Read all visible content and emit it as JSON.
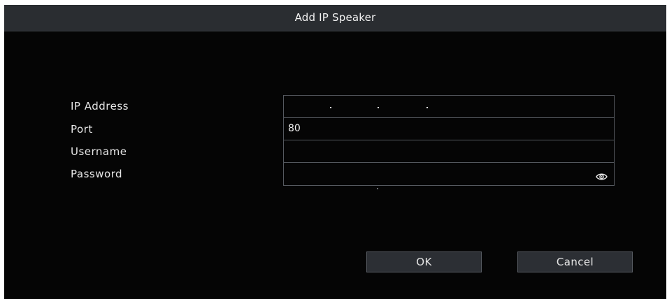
{
  "dialog": {
    "title": "Add IP Speaker"
  },
  "form": {
    "ip_address": {
      "label": "IP Address",
      "value": ". . ."
    },
    "port": {
      "label": "Port",
      "value": "80"
    },
    "username": {
      "label": "Username",
      "value": ""
    },
    "password": {
      "label": "Password",
      "value": "",
      "toggle_icon": "eye-icon"
    }
  },
  "buttons": {
    "ok_label": "OK",
    "cancel_label": "Cancel"
  },
  "colors": {
    "background": "#050505",
    "titlebar": "#2a2d31",
    "field_border": "#55595f",
    "button": "#2c2f34",
    "text": "#e6e6e6"
  }
}
